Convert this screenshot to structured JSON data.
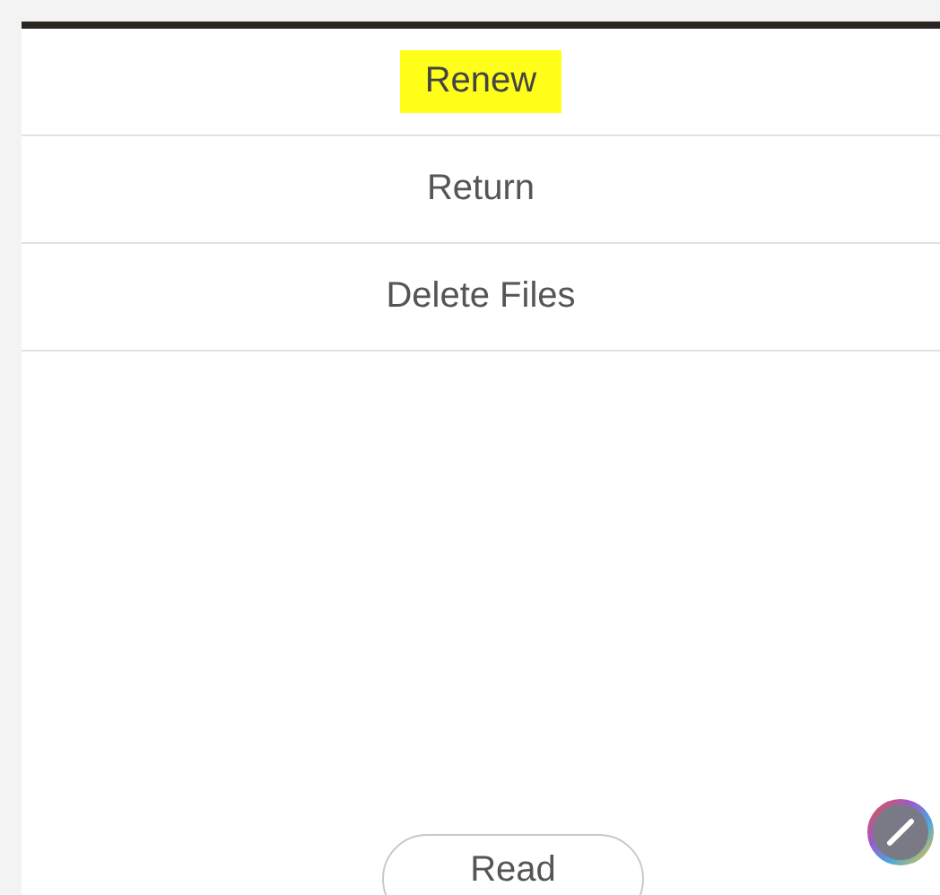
{
  "menu_items": [
    {
      "label": "Renew",
      "highlighted": true
    },
    {
      "label": "Return",
      "highlighted": false
    },
    {
      "label": "Delete Files",
      "highlighted": false
    }
  ],
  "read_button": {
    "label": "Read"
  }
}
